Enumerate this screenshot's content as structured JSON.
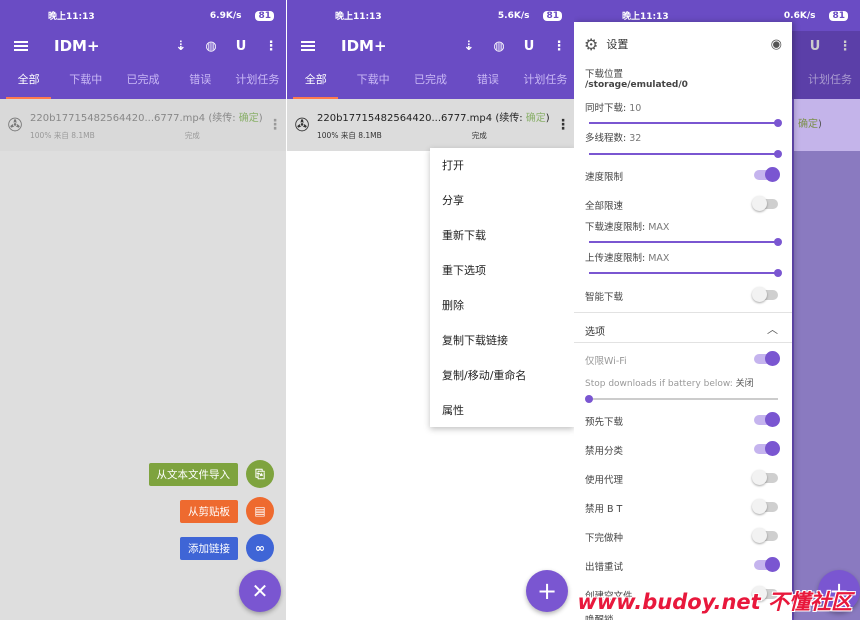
{
  "status": {
    "time": "晚上11:13",
    "speeds": [
      "6.9K/s",
      "5.6K/s",
      "0.6K/s"
    ],
    "battery": "81"
  },
  "app": {
    "title": "IDM+"
  },
  "tabs": [
    "全部",
    "下载中",
    "已完成",
    "错误",
    "计划任务"
  ],
  "download": {
    "filename": "220b17715482564420...6777.mp4",
    "resume_label": "(续传: ",
    "resume_value": "确定",
    "resume_close": ")",
    "progress": "100% 来自 8.1MB",
    "state": "完成"
  },
  "fab_actions": [
    {
      "label": "从文本文件导入",
      "color": "#7ea33e"
    },
    {
      "label": "从剪贴板",
      "color": "#ee6a2f"
    },
    {
      "label": "添加链接",
      "color": "#3f65d6"
    }
  ],
  "context_menu": [
    "打开",
    "分享",
    "重新下载",
    "重下选项",
    "删除",
    "复制下载链接",
    "复制/移动/重命名",
    "属性"
  ],
  "settings": {
    "title": "设置",
    "download_location_label": "下载位置",
    "download_location_value": "/storage/emulated/0",
    "concurrent_label": "同时下载:",
    "concurrent_value": "10",
    "threads_label": "多线程数:",
    "threads_value": "32",
    "speed_limit": "速度限制",
    "global_limit": "全部限速",
    "dl_speed_label": "下载速度限制:",
    "dl_speed_value": "MAX",
    "ul_speed_label": "上传速度限制:",
    "ul_speed_value": "MAX",
    "smart_download": "智能下载",
    "options_header": "选项",
    "wifi_only": "仅限Wi-Fi",
    "battery_label": "Stop downloads if battery below:",
    "battery_value": "关闭",
    "predownload": "预先下载",
    "disable_category": "禁用分类",
    "use_proxy": "使用代理",
    "disable_bt": "禁用 B T",
    "seed_after": "下完做种",
    "retry_on_error": "出错重试",
    "create_empty": "创建空文件",
    "last_row": "唤醒锁"
  },
  "toggles": {
    "speed_limit": true,
    "global_limit": false,
    "smart_download": false,
    "wifi_only": true,
    "predownload": true,
    "disable_category": true,
    "use_proxy": false,
    "disable_bt": false,
    "seed_after": false,
    "retry_on_error": true
  },
  "watermark": "www.budoy.net 不懂社区",
  "colors": {
    "primary": "#6a4cc4",
    "accent": "#7a56d1",
    "tab_indicator": "#ff7b4d"
  }
}
